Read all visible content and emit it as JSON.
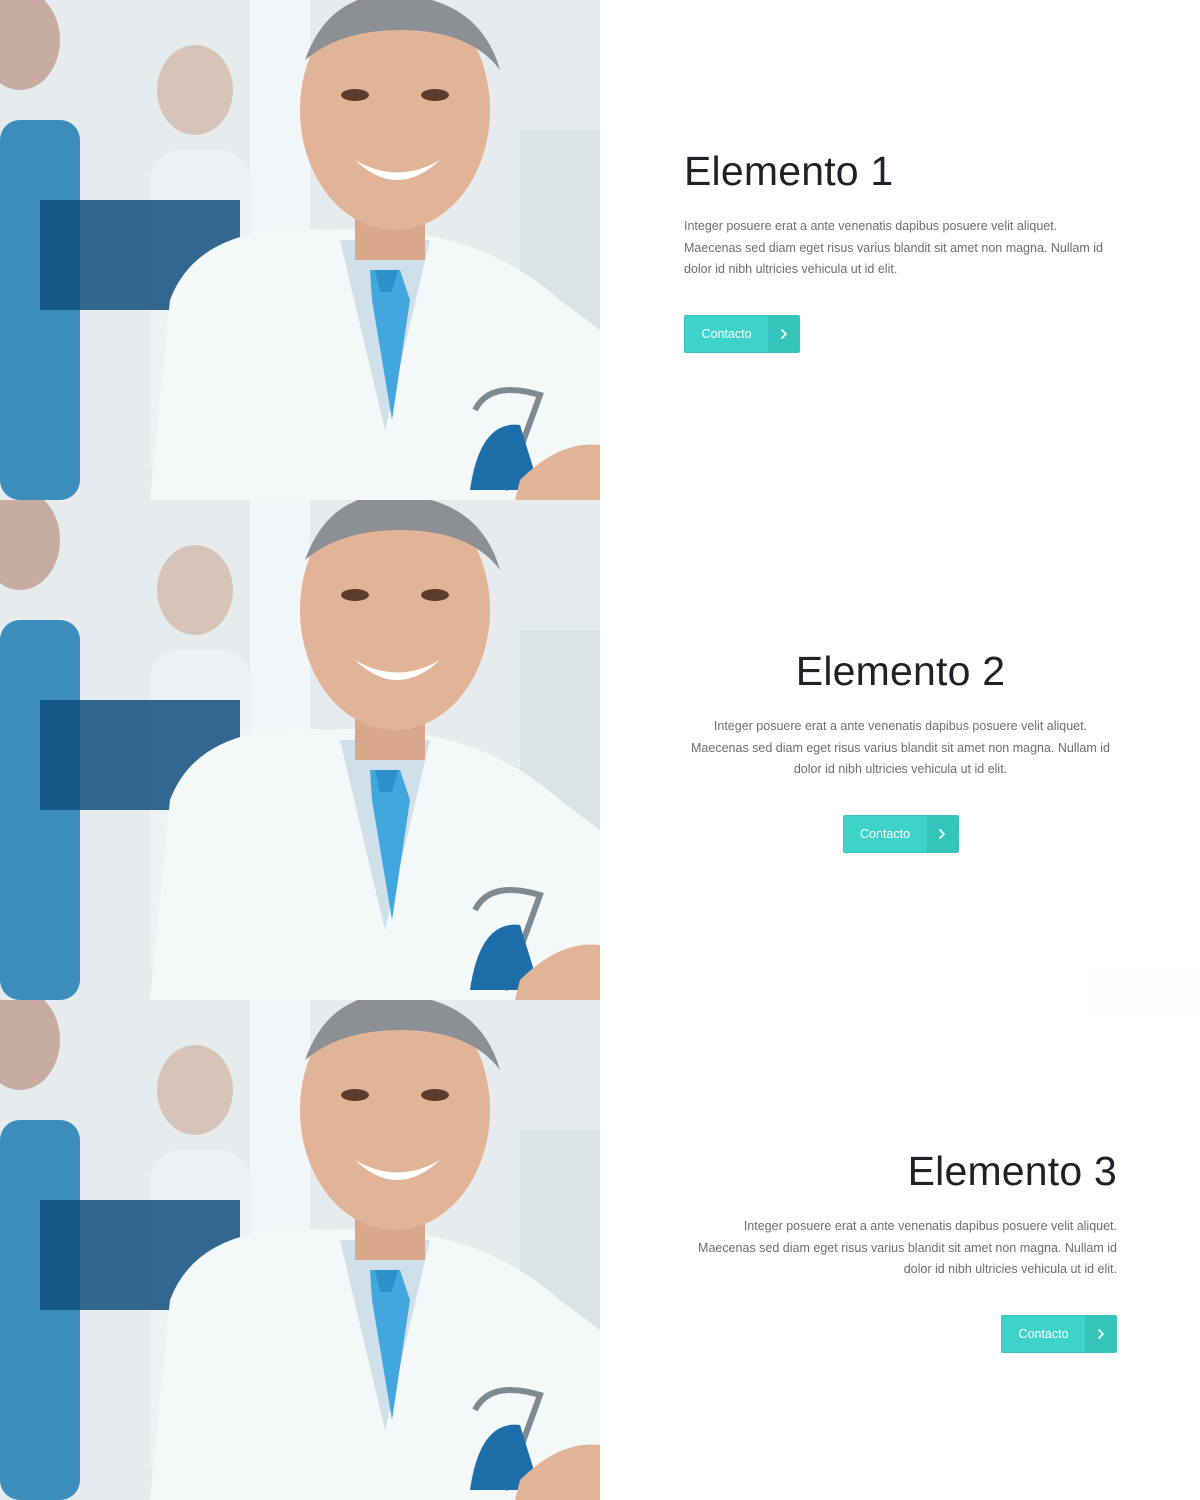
{
  "items": [
    {
      "title": "Elemento 1",
      "text": "Integer posuere erat a ante venenatis dapibus posuere velit aliquet. Maecenas sed diam eget risus varius blandit sit amet non magna. Nullam id dolor id nibh ultricies vehicula ut id elit.",
      "button_label": "Contacto",
      "align": "left",
      "image_icon": "doctor-photo-icon"
    },
    {
      "title": "Elemento 2",
      "text": "Integer posuere erat a ante venenatis dapibus posuere velit aliquet. Maecenas sed diam eget risus varius blandit sit amet non magna. Nullam id dolor id nibh ultricies vehicula ut id elit.",
      "button_label": "Contacto",
      "align": "center",
      "image_icon": "doctor-photo-icon"
    },
    {
      "title": "Elemento 3",
      "text": "Integer posuere erat a ante venenatis dapibus posuere velit aliquet. Maecenas sed diam eget risus varius blandit sit amet non magna. Nullam id dolor id nibh ultricies vehicula ut id elit.",
      "button_label": "Contacto",
      "align": "right",
      "image_icon": "doctor-photo-icon"
    }
  ],
  "colors": {
    "accent": "#3ed3c9",
    "accent_dark": "#34c4ba",
    "heading": "#1f2126",
    "body_text": "#6b6e73",
    "background": "#ffffff"
  }
}
